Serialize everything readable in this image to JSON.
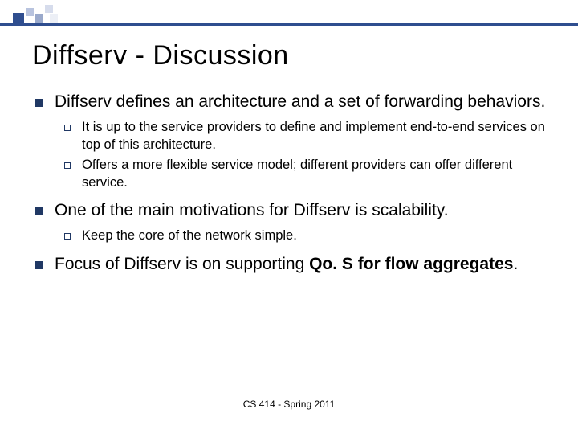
{
  "title": "Diffserv - Discussion",
  "bullets": [
    {
      "html": "Diffserv defines an architecture and a set of forwarding behaviors.",
      "sub": [
        "It is up to the service providers to define and implement end-to-end services on top of this architecture.",
        "Offers a more flexible service model; different providers can offer different service."
      ]
    },
    {
      "html": "One of the main motivations for Diffserv is scalability.",
      "sub": [
        "Keep the core of the network simple."
      ]
    },
    {
      "html": "Focus of Diffserv is on supporting <b>Qo. S for flow aggregates</b>.",
      "sub": []
    }
  ],
  "footer": "CS 414 - Spring 2011",
  "colors": {
    "accent": "#2f4e8f",
    "bullet": "#203864"
  }
}
